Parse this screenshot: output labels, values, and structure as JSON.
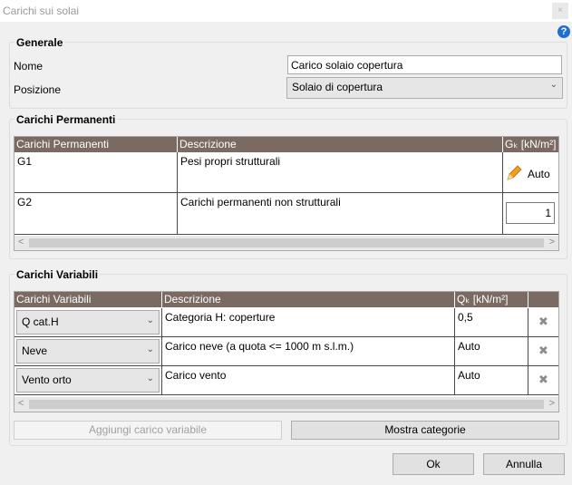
{
  "window": {
    "title": "Carichi sui solai",
    "close_glyph": "×"
  },
  "help": {
    "glyph": "?"
  },
  "generale": {
    "title": "Generale",
    "nome_label": "Nome",
    "nome_value": "Carico solaio copertura",
    "posizione_label": "Posizione",
    "posizione_value": "Solaio di copertura"
  },
  "permanenti": {
    "title": "Carichi Permanenti",
    "columns": [
      "Carichi Permanenti",
      "Descrizione",
      "Gₖ [kN/m²]"
    ],
    "rows": [
      {
        "name": "G1",
        "description": "Pesi propri strutturali",
        "value": "Auto"
      },
      {
        "name": "G2",
        "description": "Carichi permanenti non strutturali",
        "value": "1"
      }
    ]
  },
  "variabili": {
    "title": "Carichi Variabili",
    "columns": [
      "Carichi Variabili",
      "Descrizione",
      "Qₖ [kN/m²]",
      ""
    ],
    "rows": [
      {
        "name": "Q cat.H",
        "description": "Categoria H: coperture",
        "value": "0,5"
      },
      {
        "name": "Neve",
        "description": "Carico neve (a quota <= 1000 m s.l.m.)",
        "value": "Auto"
      },
      {
        "name": "Vento orto",
        "description": "Carico vento",
        "value": "Auto"
      }
    ]
  },
  "buttons": {
    "add_variable": "Aggiungi carico variabile",
    "show_categories": "Mostra categorie",
    "ok": "Ok",
    "cancel": "Annulla"
  },
  "colors": {
    "grid_header": "#7a6a62",
    "accent_help": "#1f6fd1",
    "pencil": "#f0a020"
  },
  "icons": {
    "pencil": "pencil-icon",
    "delete": "delete-icon",
    "chevron": "chevron-down-icon"
  }
}
